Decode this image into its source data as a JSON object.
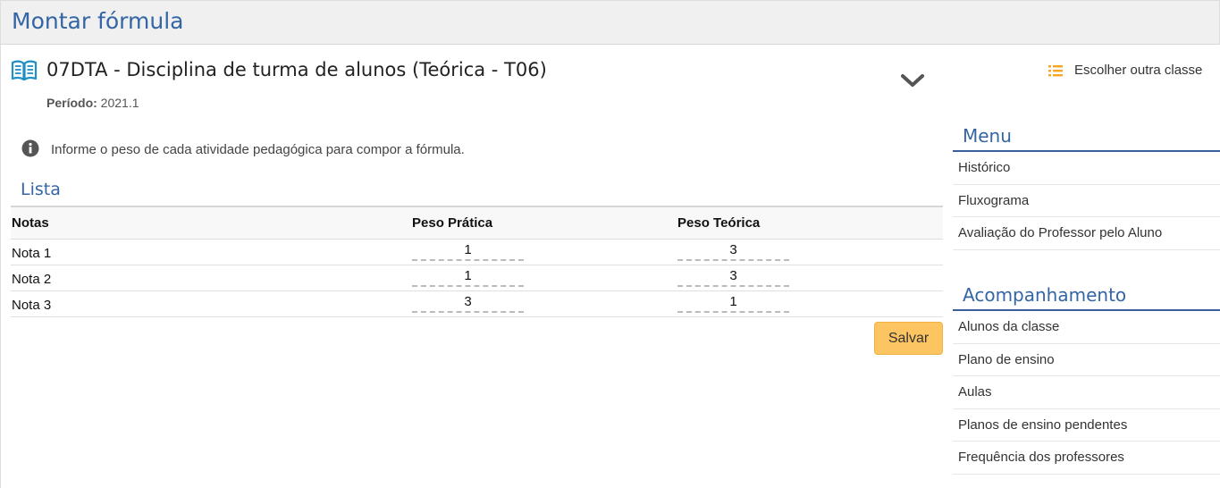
{
  "page": {
    "title": "Montar fórmula"
  },
  "class_info": {
    "title": "07DTA - Disciplina de turma de alunos (Teórica - T06)",
    "periodo_label": "Período:",
    "periodo_value": "2021.1",
    "choose_class_label": "Escolher outra classe"
  },
  "info_message": "Informe o peso de cada atividade pedagógica para compor a fórmula.",
  "lista": {
    "title": "Lista",
    "columns": [
      "Notas",
      "Peso Prática",
      "Peso Teórica"
    ],
    "rows": [
      {
        "name": "Nota 1",
        "peso_pratica": "1",
        "peso_teorica": "3"
      },
      {
        "name": "Nota 2",
        "peso_pratica": "1",
        "peso_teorica": "3"
      },
      {
        "name": "Nota 3",
        "peso_pratica": "3",
        "peso_teorica": "1"
      }
    ],
    "save_label": "Salvar"
  },
  "sidebar": {
    "menu": {
      "title": "Menu",
      "items": [
        "Histórico",
        "Fluxograma",
        "Avaliação do Professor pelo Aluno"
      ]
    },
    "acompanhamento": {
      "title": "Acompanhamento",
      "items": [
        "Alunos da classe",
        "Plano de ensino",
        "Aulas",
        "Planos de ensino pendentes",
        "Frequência dos professores"
      ]
    }
  },
  "colors": {
    "accent": "#3465a4",
    "button": "#fcc561",
    "list_icon": "#f5a623"
  },
  "icons": {
    "class": "open-book-icon",
    "collapse": "chevron-down-icon",
    "choose_class": "list-icon",
    "info": "info-circle-icon"
  }
}
